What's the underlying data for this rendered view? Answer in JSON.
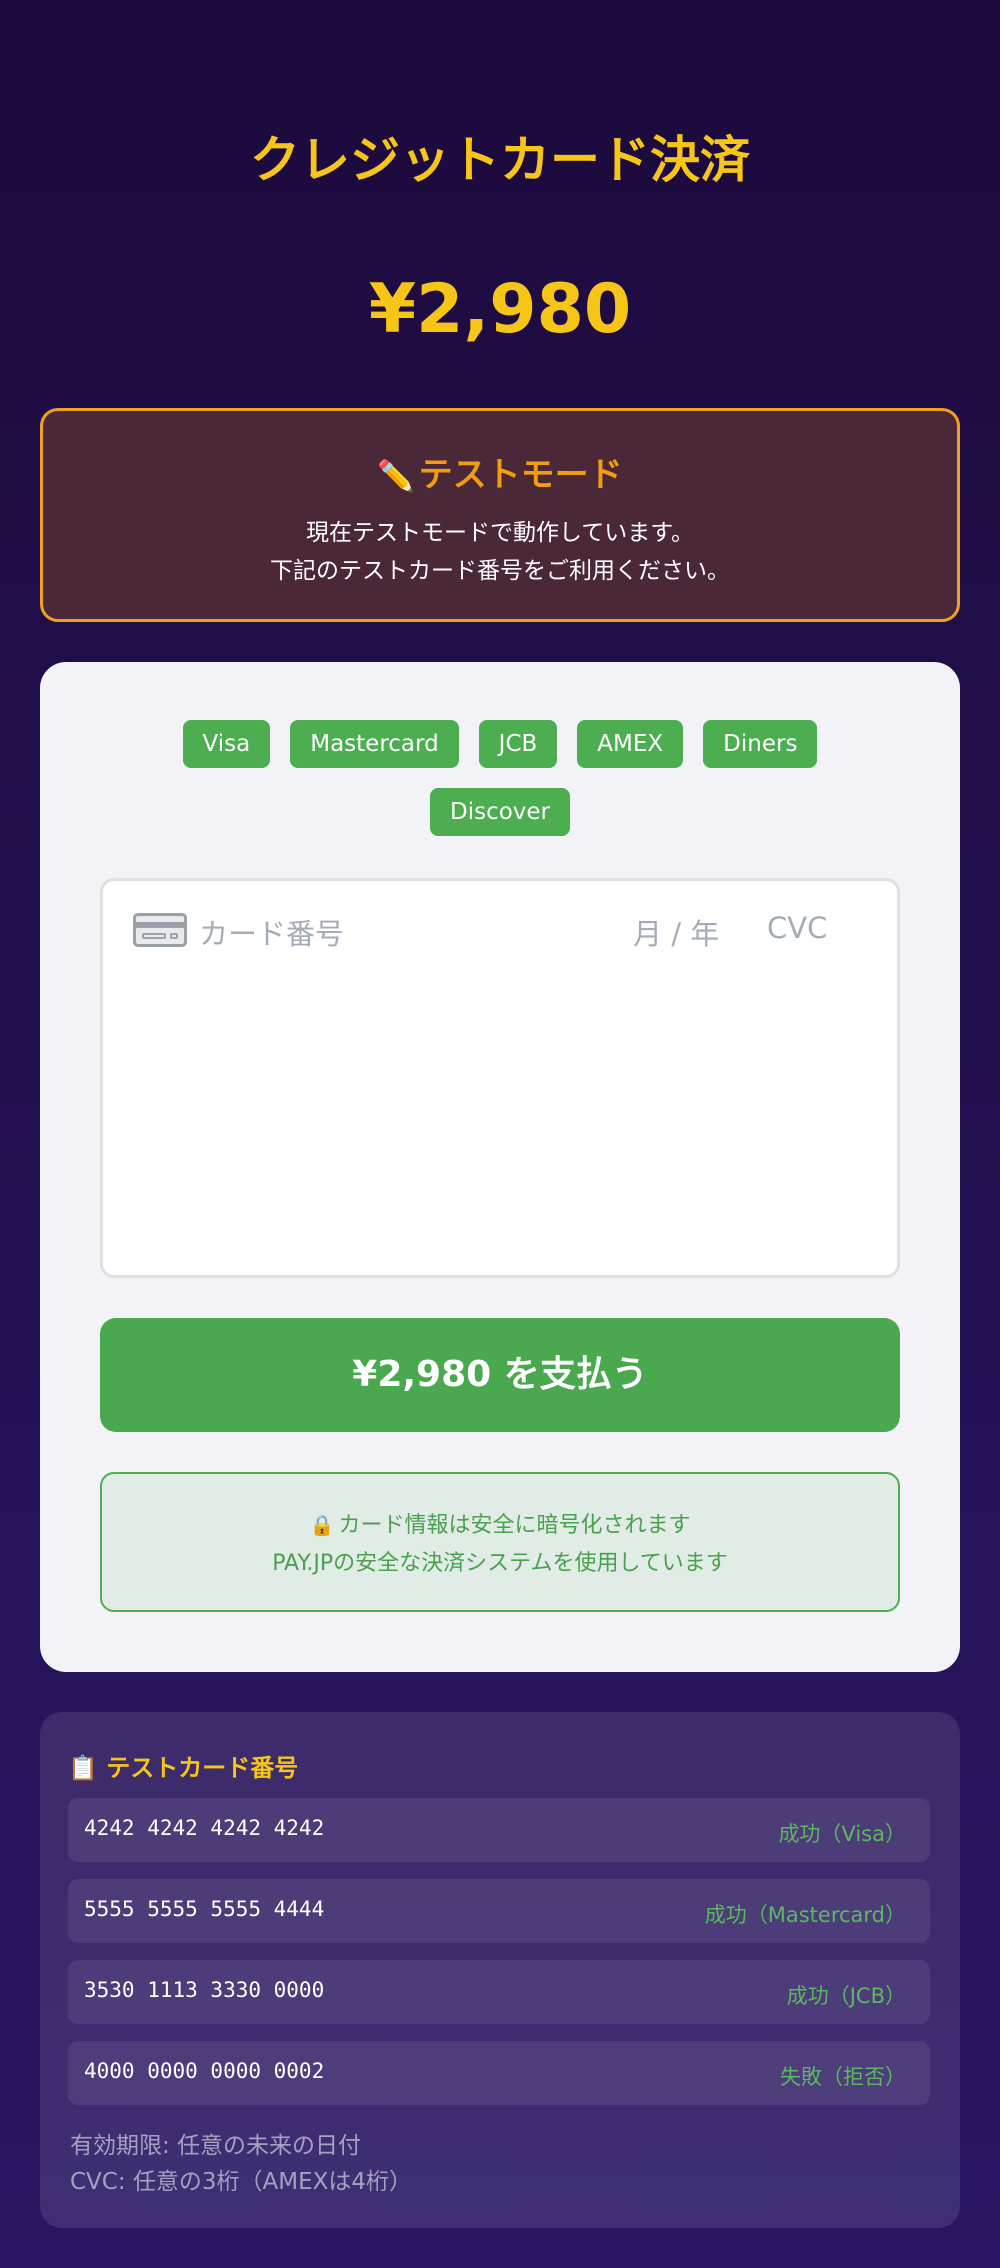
{
  "header": {
    "title": "クレジットカード決済",
    "amount": "¥2,980"
  },
  "test_mode": {
    "icon": "pencil-icon",
    "heading": "テストモード",
    "line1": "現在テストモードで動作しています。",
    "line2": "下記のテストカード番号をご利用ください。"
  },
  "payment": {
    "brands": [
      "Visa",
      "Mastercard",
      "JCB",
      "AMEX",
      "Diners",
      "Discover"
    ],
    "card_number_placeholder": "カード番号",
    "expiry_placeholder": "月 / 年",
    "cvc_placeholder": "CVC",
    "pay_button_label": "¥2,980 を支払う",
    "secure_line1": "カード情報は安全に暗号化されます",
    "secure_line2": "PAY.JPの安全な決済システムを使用しています",
    "accent_color": "#4cae50"
  },
  "test_cards": {
    "title": "テストカード番号",
    "rows": [
      {
        "number": "4242 4242 4242 4242",
        "result": "成功（Visa）"
      },
      {
        "number": "5555 5555 5555 4444",
        "result": "成功（Mastercard）"
      },
      {
        "number": "3530 1113 3330 0000",
        "result": "成功（JCB）"
      },
      {
        "number": "4000 0000 0000 0002",
        "result": "失敗（拒否）"
      }
    ],
    "note_expiry": "有効期限: 任意の未来の日付",
    "note_cvc": "CVC: 任意の3桁（AMEXは4桁）"
  },
  "colors": {
    "gold": "#f5c518",
    "warning": "#f39c12",
    "success": "#4cae50"
  }
}
